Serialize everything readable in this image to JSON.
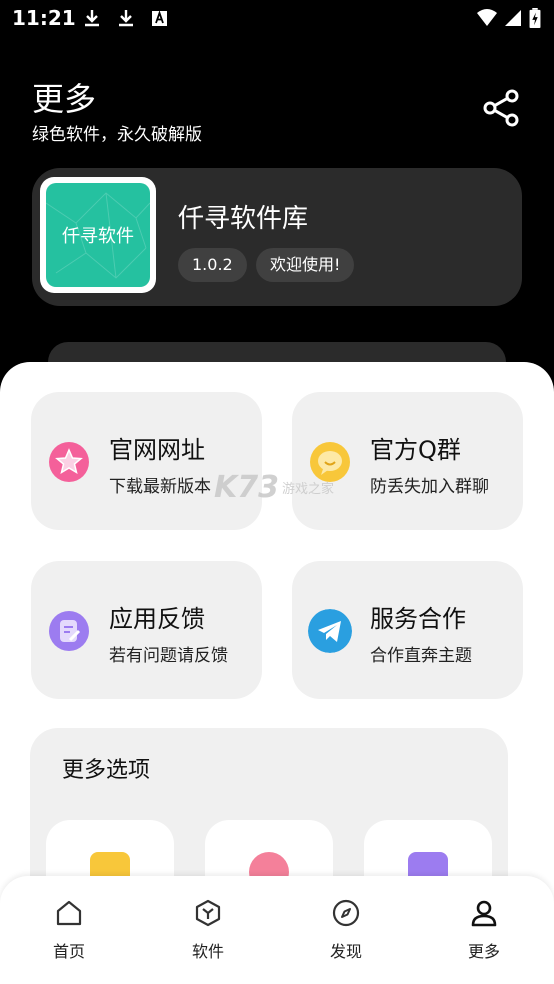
{
  "status_bar": {
    "time": "11:21"
  },
  "header": {
    "title": "更多",
    "subtitle": "绿色软件，永久破解版"
  },
  "app_card": {
    "logo_text": "仟寻软件",
    "name": "仟寻软件库",
    "version": "1.0.2",
    "welcome": "欢迎使用!"
  },
  "tiles": [
    {
      "title": "官网网址",
      "subtitle": "下载最新版本",
      "icon": "star-icon",
      "color": "#f4609a"
    },
    {
      "title": "官方Q群",
      "subtitle": "防丢失加入群聊",
      "icon": "chat-icon",
      "color": "#f8c73a"
    },
    {
      "title": "应用反馈",
      "subtitle": "若有问题请反馈",
      "icon": "feedback-icon",
      "color": "#9c7cf0"
    },
    {
      "title": "服务合作",
      "subtitle": "合作直奔主题",
      "icon": "telegram-icon",
      "color": "#2a9fe0"
    }
  ],
  "more_options": {
    "title": "更多选项"
  },
  "watermark": {
    "text": "K73",
    "sub": "游戏之家"
  },
  "nav": {
    "items": [
      {
        "label": "首页",
        "icon": "home-icon"
      },
      {
        "label": "软件",
        "icon": "box-icon"
      },
      {
        "label": "发现",
        "icon": "compass-icon"
      },
      {
        "label": "更多",
        "icon": "user-icon"
      }
    ]
  }
}
